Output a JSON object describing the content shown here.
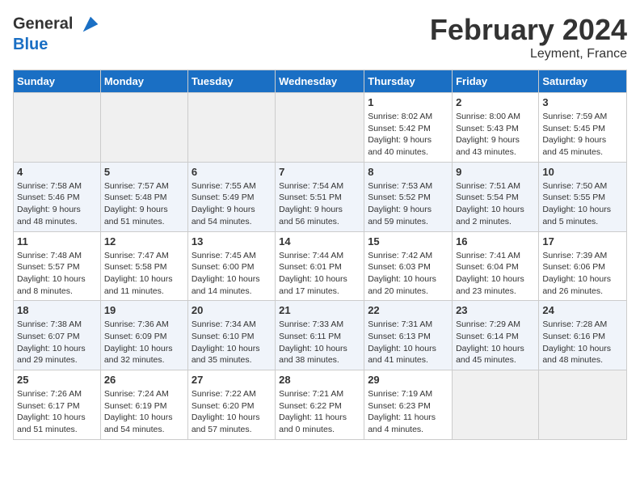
{
  "header": {
    "logo_line1": "General",
    "logo_line2": "Blue",
    "month_title": "February 2024",
    "location": "Leyment, France"
  },
  "columns": [
    "Sunday",
    "Monday",
    "Tuesday",
    "Wednesday",
    "Thursday",
    "Friday",
    "Saturday"
  ],
  "weeks": [
    {
      "style": "row-white",
      "days": [
        {
          "num": "",
          "info": "",
          "empty": true
        },
        {
          "num": "",
          "info": "",
          "empty": true
        },
        {
          "num": "",
          "info": "",
          "empty": true
        },
        {
          "num": "",
          "info": "",
          "empty": true
        },
        {
          "num": "1",
          "info": "Sunrise: 8:02 AM\nSunset: 5:42 PM\nDaylight: 9 hours\nand 40 minutes.",
          "empty": false
        },
        {
          "num": "2",
          "info": "Sunrise: 8:00 AM\nSunset: 5:43 PM\nDaylight: 9 hours\nand 43 minutes.",
          "empty": false
        },
        {
          "num": "3",
          "info": "Sunrise: 7:59 AM\nSunset: 5:45 PM\nDaylight: 9 hours\nand 45 minutes.",
          "empty": false
        }
      ]
    },
    {
      "style": "row-blue",
      "days": [
        {
          "num": "4",
          "info": "Sunrise: 7:58 AM\nSunset: 5:46 PM\nDaylight: 9 hours\nand 48 minutes.",
          "empty": false
        },
        {
          "num": "5",
          "info": "Sunrise: 7:57 AM\nSunset: 5:48 PM\nDaylight: 9 hours\nand 51 minutes.",
          "empty": false
        },
        {
          "num": "6",
          "info": "Sunrise: 7:55 AM\nSunset: 5:49 PM\nDaylight: 9 hours\nand 54 minutes.",
          "empty": false
        },
        {
          "num": "7",
          "info": "Sunrise: 7:54 AM\nSunset: 5:51 PM\nDaylight: 9 hours\nand 56 minutes.",
          "empty": false
        },
        {
          "num": "8",
          "info": "Sunrise: 7:53 AM\nSunset: 5:52 PM\nDaylight: 9 hours\nand 59 minutes.",
          "empty": false
        },
        {
          "num": "9",
          "info": "Sunrise: 7:51 AM\nSunset: 5:54 PM\nDaylight: 10 hours\nand 2 minutes.",
          "empty": false
        },
        {
          "num": "10",
          "info": "Sunrise: 7:50 AM\nSunset: 5:55 PM\nDaylight: 10 hours\nand 5 minutes.",
          "empty": false
        }
      ]
    },
    {
      "style": "row-white",
      "days": [
        {
          "num": "11",
          "info": "Sunrise: 7:48 AM\nSunset: 5:57 PM\nDaylight: 10 hours\nand 8 minutes.",
          "empty": false
        },
        {
          "num": "12",
          "info": "Sunrise: 7:47 AM\nSunset: 5:58 PM\nDaylight: 10 hours\nand 11 minutes.",
          "empty": false
        },
        {
          "num": "13",
          "info": "Sunrise: 7:45 AM\nSunset: 6:00 PM\nDaylight: 10 hours\nand 14 minutes.",
          "empty": false
        },
        {
          "num": "14",
          "info": "Sunrise: 7:44 AM\nSunset: 6:01 PM\nDaylight: 10 hours\nand 17 minutes.",
          "empty": false
        },
        {
          "num": "15",
          "info": "Sunrise: 7:42 AM\nSunset: 6:03 PM\nDaylight: 10 hours\nand 20 minutes.",
          "empty": false
        },
        {
          "num": "16",
          "info": "Sunrise: 7:41 AM\nSunset: 6:04 PM\nDaylight: 10 hours\nand 23 minutes.",
          "empty": false
        },
        {
          "num": "17",
          "info": "Sunrise: 7:39 AM\nSunset: 6:06 PM\nDaylight: 10 hours\nand 26 minutes.",
          "empty": false
        }
      ]
    },
    {
      "style": "row-blue",
      "days": [
        {
          "num": "18",
          "info": "Sunrise: 7:38 AM\nSunset: 6:07 PM\nDaylight: 10 hours\nand 29 minutes.",
          "empty": false
        },
        {
          "num": "19",
          "info": "Sunrise: 7:36 AM\nSunset: 6:09 PM\nDaylight: 10 hours\nand 32 minutes.",
          "empty": false
        },
        {
          "num": "20",
          "info": "Sunrise: 7:34 AM\nSunset: 6:10 PM\nDaylight: 10 hours\nand 35 minutes.",
          "empty": false
        },
        {
          "num": "21",
          "info": "Sunrise: 7:33 AM\nSunset: 6:11 PM\nDaylight: 10 hours\nand 38 minutes.",
          "empty": false
        },
        {
          "num": "22",
          "info": "Sunrise: 7:31 AM\nSunset: 6:13 PM\nDaylight: 10 hours\nand 41 minutes.",
          "empty": false
        },
        {
          "num": "23",
          "info": "Sunrise: 7:29 AM\nSunset: 6:14 PM\nDaylight: 10 hours\nand 45 minutes.",
          "empty": false
        },
        {
          "num": "24",
          "info": "Sunrise: 7:28 AM\nSunset: 6:16 PM\nDaylight: 10 hours\nand 48 minutes.",
          "empty": false
        }
      ]
    },
    {
      "style": "row-white",
      "days": [
        {
          "num": "25",
          "info": "Sunrise: 7:26 AM\nSunset: 6:17 PM\nDaylight: 10 hours\nand 51 minutes.",
          "empty": false
        },
        {
          "num": "26",
          "info": "Sunrise: 7:24 AM\nSunset: 6:19 PM\nDaylight: 10 hours\nand 54 minutes.",
          "empty": false
        },
        {
          "num": "27",
          "info": "Sunrise: 7:22 AM\nSunset: 6:20 PM\nDaylight: 10 hours\nand 57 minutes.",
          "empty": false
        },
        {
          "num": "28",
          "info": "Sunrise: 7:21 AM\nSunset: 6:22 PM\nDaylight: 11 hours\nand 0 minutes.",
          "empty": false
        },
        {
          "num": "29",
          "info": "Sunrise: 7:19 AM\nSunset: 6:23 PM\nDaylight: 11 hours\nand 4 minutes.",
          "empty": false
        },
        {
          "num": "",
          "info": "",
          "empty": true
        },
        {
          "num": "",
          "info": "",
          "empty": true
        }
      ]
    }
  ]
}
